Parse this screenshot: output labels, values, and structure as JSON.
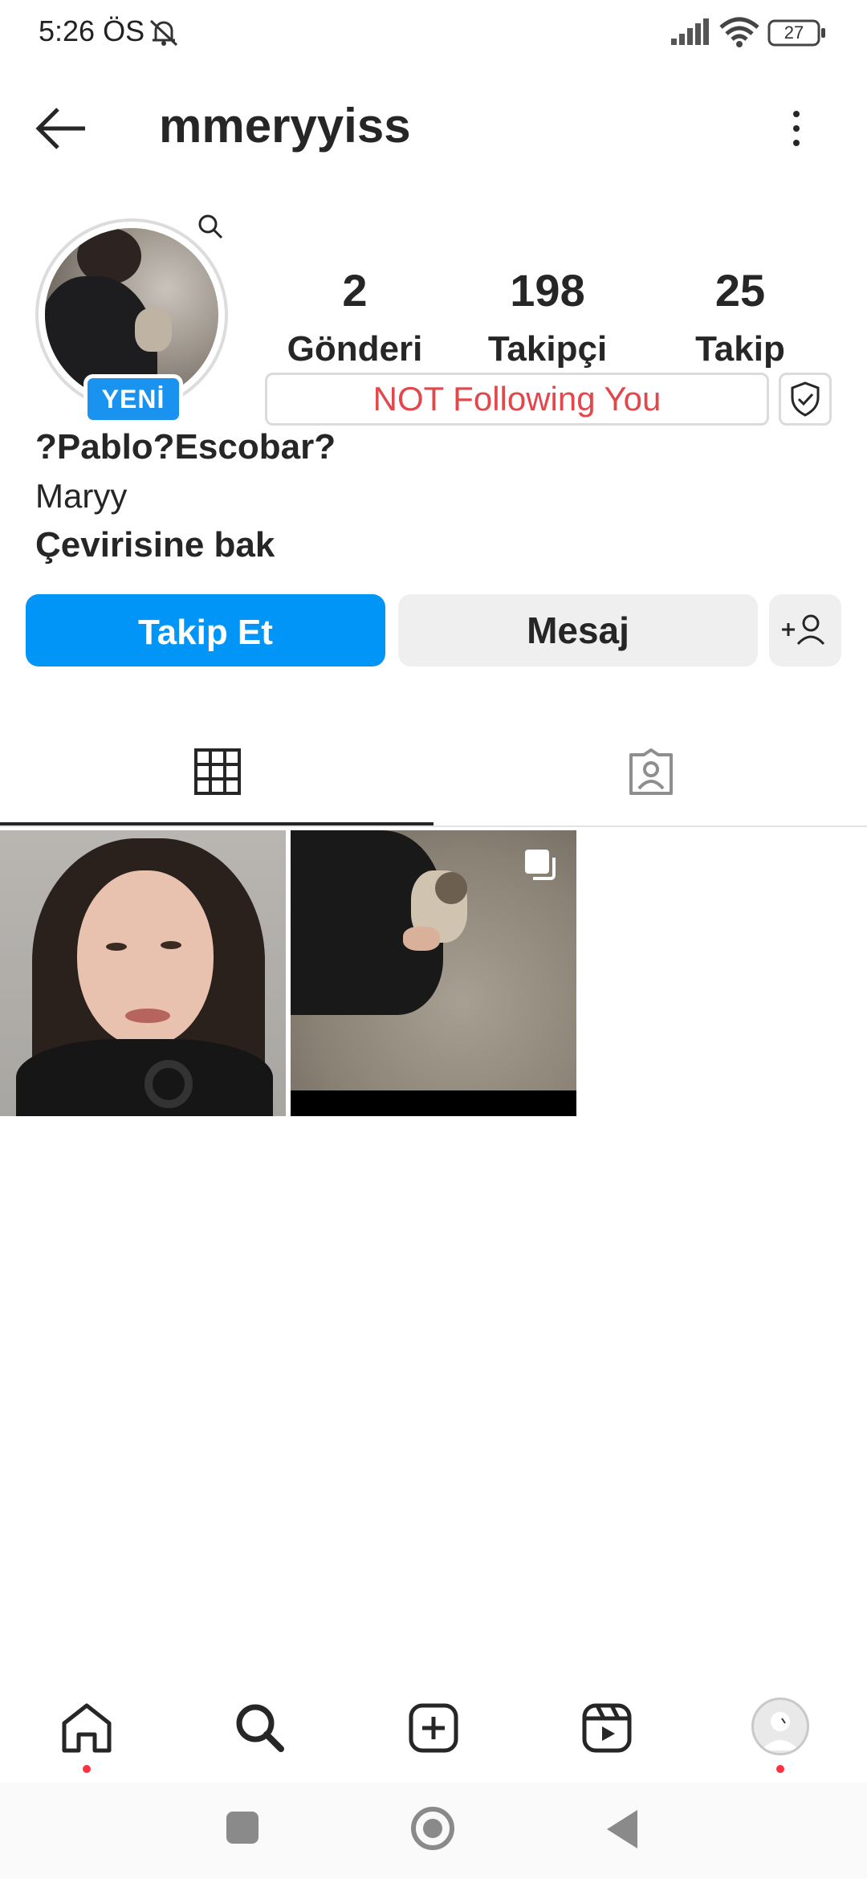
{
  "status_bar": {
    "time": "5:26 ÖS",
    "battery": "27",
    "icons": [
      "notifications-off-icon",
      "signal-icon",
      "wifi-icon",
      "battery-icon"
    ]
  },
  "header": {
    "username": "mmeryyiss",
    "icons": [
      "back-arrow-icon",
      "more-vertical-icon"
    ]
  },
  "profile": {
    "new_badge": "YENİ",
    "stats": [
      {
        "value": "2",
        "label": "Gönderi"
      },
      {
        "value": "198",
        "label": "Takipçi"
      },
      {
        "value": "25",
        "label": "Takip"
      }
    ],
    "not_following_label": "NOT Following You",
    "full_name": "?Pablo?Escobar?",
    "bio": "Maryy",
    "translate_label": "Çevirisine bak"
  },
  "actions": {
    "follow_label": "Takip Et",
    "message_label": "Mesaj"
  },
  "tabs": [
    {
      "icon": "grid-icon",
      "active": true
    },
    {
      "icon": "tagged-person-icon",
      "active": false
    }
  ],
  "posts": [
    {
      "icon": null
    },
    {
      "icon": "multiple-images-icon"
    }
  ],
  "bottom_nav": [
    "home-icon",
    "search-icon",
    "create-icon",
    "reels-icon",
    "profile-avatar"
  ],
  "colors": {
    "primary": "#0095f6",
    "badge": "#1a93f0",
    "alert_text": "#e2474b",
    "notification_dot": "#ff3040"
  }
}
